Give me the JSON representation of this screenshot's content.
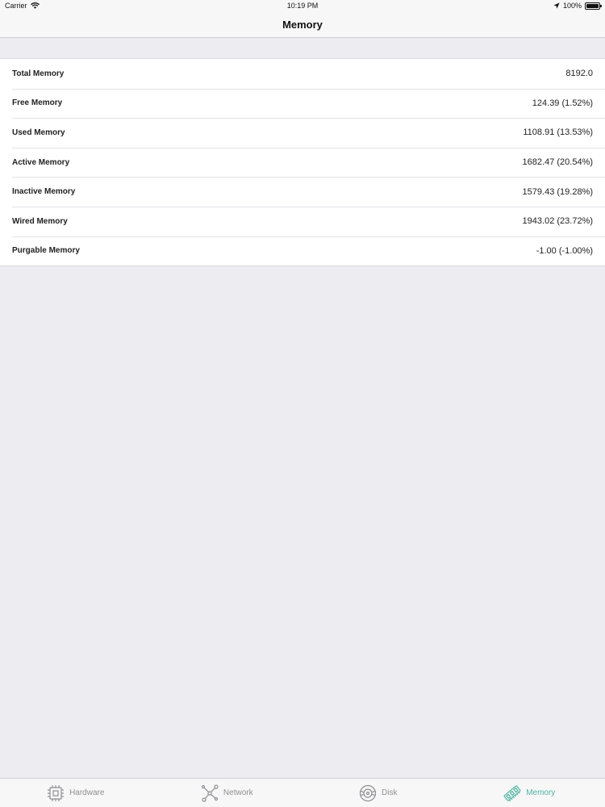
{
  "status_bar": {
    "carrier": "Carrier",
    "time": "10:19 PM",
    "battery": "100%"
  },
  "nav": {
    "title": "Memory"
  },
  "memory_rows": [
    {
      "label": "Total Memory",
      "value": "8192.0"
    },
    {
      "label": "Free Memory",
      "value": "124.39 (1.52%)"
    },
    {
      "label": "Used Memory",
      "value": "1108.91 (13.53%)"
    },
    {
      "label": "Active Memory",
      "value": "1682.47 (20.54%)"
    },
    {
      "label": "Inactive Memory",
      "value": "1579.43 (19.28%)"
    },
    {
      "label": "Wired Memory",
      "value": "1943.02 (23.72%)"
    },
    {
      "label": "Purgable Memory",
      "value": "-1.00 (-1.00%)"
    }
  ],
  "tabs": [
    {
      "label": "Hardware",
      "icon": "chip-icon"
    },
    {
      "label": "Network",
      "icon": "network-icon"
    },
    {
      "label": "Disk",
      "icon": "disk-icon"
    },
    {
      "label": "Memory",
      "icon": "memory-icon",
      "active": true
    }
  ],
  "colors": {
    "accent": "#4fb3a3",
    "inactive_tab": "#8e8e93",
    "background": "#ececf1"
  }
}
